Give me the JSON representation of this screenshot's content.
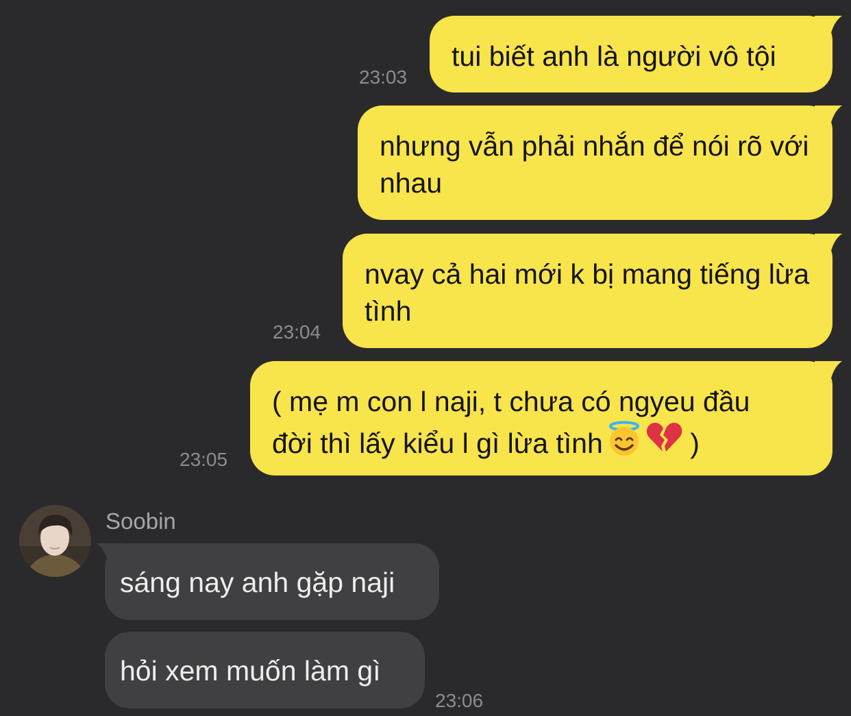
{
  "messages": [
    {
      "direction": "outgoing",
      "text": "tui biết anh là người vô tội",
      "time": "23:03"
    },
    {
      "direction": "outgoing",
      "text": "nhưng vẫn phải nhắn để nói rõ với nhau"
    },
    {
      "direction": "outgoing",
      "text": "nvay cả hai mới k bị mang tiếng lừa tình",
      "time": "23:04"
    },
    {
      "direction": "outgoing",
      "text_line1": "( mẹ m con l naji, t chưa có ngyeu đầu",
      "text_line2": "đời thì lấy kiểu l gì lừa tình",
      "emojis": [
        "smiling-face-with-halo-icon",
        "broken-heart-icon"
      ],
      "text_end": " )",
      "time": "23:05"
    },
    {
      "direction": "incoming",
      "sender": "Soobin",
      "text": "sáng nay anh gặp naji"
    },
    {
      "direction": "incoming",
      "text": "hỏi xem muốn làm gì",
      "time": "23:06"
    }
  ],
  "colors": {
    "background": "#2a2a2c",
    "outgoing_bubble": "#f8e44b",
    "incoming_bubble": "#404042",
    "timestamp": "#8c8c8e"
  }
}
